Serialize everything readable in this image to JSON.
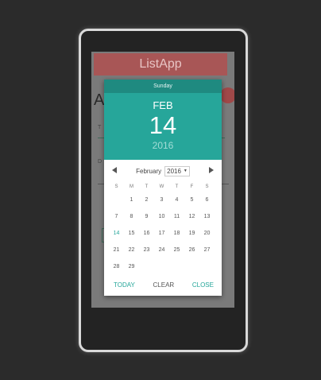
{
  "app": {
    "title": "ListApp",
    "bg_heading": "A",
    "bg_field_short": "T",
    "bg_field_short2": "D"
  },
  "picker": {
    "weekday": "Sunday",
    "month_short": "FEB",
    "day": "14",
    "year": "2016",
    "nav": {
      "month": "February",
      "year": "2016"
    },
    "weekdays": [
      "S",
      "M",
      "T",
      "W",
      "T",
      "F",
      "S"
    ],
    "weeks": [
      [
        "",
        "1",
        "2",
        "3",
        "4",
        "5",
        "6"
      ],
      [
        "7",
        "8",
        "9",
        "10",
        "11",
        "12",
        "13"
      ],
      [
        "14",
        "15",
        "16",
        "17",
        "18",
        "19",
        "20"
      ],
      [
        "21",
        "22",
        "23",
        "24",
        "25",
        "26",
        "27"
      ],
      [
        "28",
        "29",
        "",
        "",
        "",
        "",
        ""
      ]
    ],
    "selected": "14",
    "actions": {
      "today": "TODAY",
      "clear": "CLEAR",
      "close": "CLOSE"
    }
  },
  "colors": {
    "accent": "#26a69a",
    "header_dark": "#1f8a80",
    "appbar": "#a85656"
  }
}
